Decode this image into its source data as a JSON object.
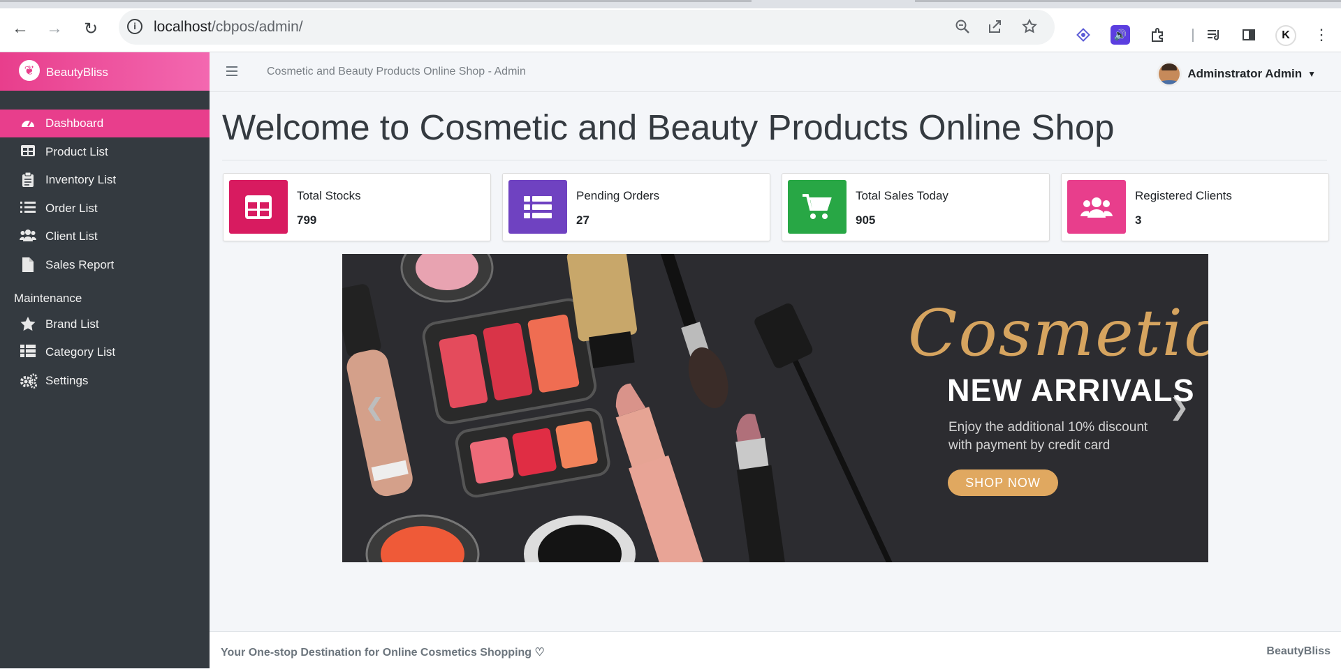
{
  "browser": {
    "url_host": "localhost",
    "url_path": "/cbpos/admin/"
  },
  "sidebar": {
    "brand_name": "BeautyBliss",
    "items": [
      {
        "label": "Dashboard",
        "icon": "tachometer-icon"
      },
      {
        "label": "Product List",
        "icon": "table-icon"
      },
      {
        "label": "Inventory List",
        "icon": "clipboard-list-icon"
      },
      {
        "label": "Order List",
        "icon": "list-icon"
      },
      {
        "label": "Client List",
        "icon": "users-icon"
      },
      {
        "label": "Sales Report",
        "icon": "file-icon"
      }
    ],
    "maintenance_header": "Maintenance",
    "maintenance_items": [
      {
        "label": "Brand List",
        "icon": "star-icon"
      },
      {
        "label": "Category List",
        "icon": "th-list-icon"
      },
      {
        "label": "Settings",
        "icon": "cogs-icon"
      }
    ]
  },
  "header": {
    "title": "Cosmetic and Beauty Products Online Shop - Admin",
    "user_name": "Adminstrator Admin"
  },
  "main": {
    "welcome": "Welcome to Cosmetic and Beauty Products Online Shop",
    "cards": [
      {
        "label": "Total Stocks",
        "value": "799",
        "color": "#d81b60",
        "icon": "table-icon"
      },
      {
        "label": "Pending Orders",
        "value": "27",
        "color": "#6f42c1",
        "icon": "list-icon"
      },
      {
        "label": "Total Sales Today",
        "value": "905",
        "color": "#28a745",
        "icon": "cart-icon"
      },
      {
        "label": "Registered Clients",
        "value": "3",
        "color": "#e83e8c",
        "icon": "users-icon"
      }
    ],
    "banner": {
      "script": "Cosmetic",
      "headline": "NEW ARRIVALS",
      "discount": "Enjoy the additional 10% discount with payment by credit card",
      "cta": "SHOP NOW"
    }
  },
  "footer": {
    "left": "Your One-stop Destination for Online Cosmetics Shopping ♡",
    "right": "BeautyBliss"
  },
  "colors": {
    "accent": "#e83e8c",
    "sidebar_bg": "#343a40"
  }
}
